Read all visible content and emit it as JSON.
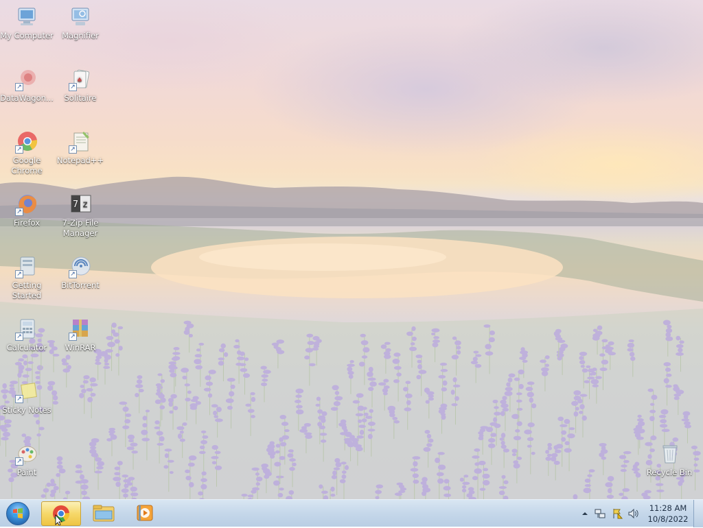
{
  "desktop": {
    "icons": [
      {
        "label": "My Computer",
        "icon": "computer-icon"
      },
      {
        "label": "Magnifier",
        "icon": "magnifier-icon"
      },
      {
        "label": "DataWagon...",
        "icon": "datawagon-icon"
      },
      {
        "label": "Solitaire",
        "icon": "solitaire-icon"
      },
      {
        "label": "Google Chrome",
        "icon": "chrome-icon"
      },
      {
        "label": "Notepad++",
        "icon": "notepadpp-icon"
      },
      {
        "label": "Firefox",
        "icon": "firefox-icon"
      },
      {
        "label": "7-Zip File Manager",
        "icon": "7zip-icon"
      },
      {
        "label": "Getting Started",
        "icon": "getting-started-icon"
      },
      {
        "label": "BitTorrent",
        "icon": "bittorrent-icon"
      },
      {
        "label": "Calculator",
        "icon": "calculator-icon"
      },
      {
        "label": "WinRAR",
        "icon": "winrar-icon"
      },
      {
        "label": "Sticky Notes",
        "icon": "sticky-notes-icon"
      },
      {
        "label": "Paint",
        "icon": "paint-icon"
      },
      {
        "label": "Recycle Bin",
        "icon": "recycle-bin-icon"
      }
    ]
  },
  "taskbar": {
    "start_icon": "windows-start-orb",
    "pinned": [
      {
        "icon": "chrome-icon",
        "active": true
      },
      {
        "icon": "file-explorer-icon",
        "active": false
      },
      {
        "icon": "media-player-icon",
        "active": false
      }
    ],
    "tray": {
      "icons": [
        "show-hidden-icons-arrow",
        "network-icon",
        "action-center-flag-icon",
        "volume-icon"
      ],
      "time": "11:28 AM",
      "date": "10/8/2022"
    }
  },
  "colors": {
    "taskbar_top": "#d9e6f2",
    "taskbar_bottom": "#b9cee4",
    "active_button": "#f6d86a",
    "flower_purple": "#b9a6e0"
  }
}
